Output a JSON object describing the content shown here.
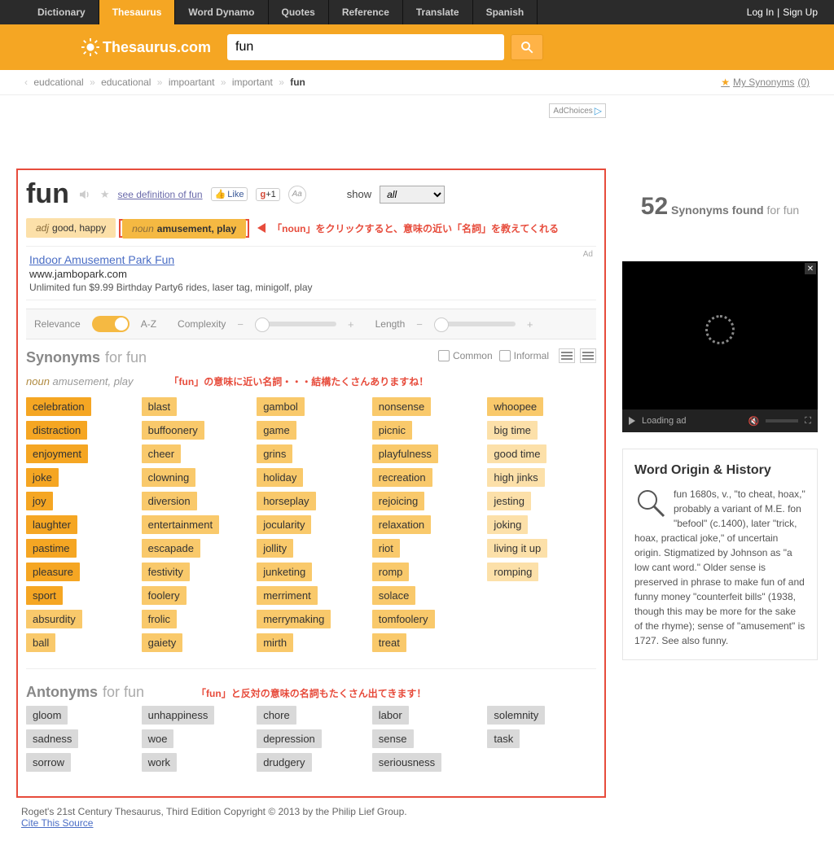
{
  "topnav": {
    "items": [
      "Dictionary",
      "Thesaurus",
      "Word Dynamo",
      "Quotes",
      "Reference",
      "Translate",
      "Spanish"
    ],
    "login": "Log In",
    "signup": "Sign Up"
  },
  "logo": "Thesaurus.com",
  "search": {
    "value": "fun"
  },
  "breadcrumbs": [
    "eudcational",
    "educational",
    "impoartant",
    "important",
    "fun"
  ],
  "my_synonyms": {
    "label": "My Synonyms",
    "count": "(0)"
  },
  "adchoices": "AdChoices",
  "word": "fun",
  "def_link": "see definition of fun",
  "fb_like": "Like",
  "gplus": "+1",
  "show_label": "show",
  "show_value": "all",
  "senses": [
    {
      "pos": "adj",
      "txt": "good, happy"
    },
    {
      "pos": "noun",
      "txt": "amusement, play"
    }
  ],
  "annot1": "「noun」をクリックすると、意味の近い「名詞」を教えてくれる",
  "ad": {
    "title": "Indoor Amusement Park Fun",
    "url": "www.jambopark.com",
    "desc": "Unlimited fun $9.99 Birthday Party6 rides, laser tag, minigolf, play",
    "tag": "Ad"
  },
  "controls": {
    "relevance": "Relevance",
    "az": "A-Z",
    "complexity": "Complexity",
    "length": "Length"
  },
  "section_syn": {
    "strong": "Synonyms",
    "light": "for fun"
  },
  "filters": {
    "common": "Common",
    "informal": "Informal"
  },
  "pos_sub": {
    "pos": "noun",
    "txt": "amusement, play"
  },
  "annot2": "「fun」の意味に近い名詞・・・結構たくさんありますね！",
  "syn_cols": [
    [
      {
        "t": "celebration",
        "s": 1
      },
      {
        "t": "distraction",
        "s": 1
      },
      {
        "t": "enjoyment",
        "s": 1
      },
      {
        "t": "joke",
        "s": 1
      },
      {
        "t": "joy",
        "s": 1
      },
      {
        "t": "laughter",
        "s": 1
      },
      {
        "t": "pastime",
        "s": 1
      },
      {
        "t": "pleasure",
        "s": 1
      },
      {
        "t": "sport",
        "s": 1
      },
      {
        "t": "absurdity",
        "s": 2
      },
      {
        "t": "ball",
        "s": 2
      }
    ],
    [
      {
        "t": "blast",
        "s": 2
      },
      {
        "t": "buffoonery",
        "s": 2
      },
      {
        "t": "cheer",
        "s": 2
      },
      {
        "t": "clowning",
        "s": 2
      },
      {
        "t": "diversion",
        "s": 2
      },
      {
        "t": "entertainment",
        "s": 2
      },
      {
        "t": "escapade",
        "s": 2
      },
      {
        "t": "festivity",
        "s": 2
      },
      {
        "t": "foolery",
        "s": 2
      },
      {
        "t": "frolic",
        "s": 2
      },
      {
        "t": "gaiety",
        "s": 2
      }
    ],
    [
      {
        "t": "gambol",
        "s": 2
      },
      {
        "t": "game",
        "s": 2
      },
      {
        "t": "grins",
        "s": 2
      },
      {
        "t": "holiday",
        "s": 2
      },
      {
        "t": "horseplay",
        "s": 2
      },
      {
        "t": "jocularity",
        "s": 2
      },
      {
        "t": "jollity",
        "s": 2
      },
      {
        "t": "junketing",
        "s": 2
      },
      {
        "t": "merriment",
        "s": 2
      },
      {
        "t": "merrymaking",
        "s": 2
      },
      {
        "t": "mirth",
        "s": 2
      }
    ],
    [
      {
        "t": "nonsense",
        "s": 2
      },
      {
        "t": "picnic",
        "s": 2
      },
      {
        "t": "playfulness",
        "s": 2
      },
      {
        "t": "recreation",
        "s": 2
      },
      {
        "t": "rejoicing",
        "s": 2
      },
      {
        "t": "relaxation",
        "s": 2
      },
      {
        "t": "riot",
        "s": 2
      },
      {
        "t": "romp",
        "s": 2
      },
      {
        "t": "solace",
        "s": 2
      },
      {
        "t": "tomfoolery",
        "s": 2
      },
      {
        "t": "treat",
        "s": 2
      }
    ],
    [
      {
        "t": "whoopee",
        "s": 2
      },
      {
        "t": "big time",
        "s": 3
      },
      {
        "t": "good time",
        "s": 3
      },
      {
        "t": "high jinks",
        "s": 3
      },
      {
        "t": "jesting",
        "s": 3
      },
      {
        "t": "joking",
        "s": 3
      },
      {
        "t": "living it up",
        "s": 3
      },
      {
        "t": "romping",
        "s": 3
      }
    ]
  ],
  "section_ant": {
    "strong": "Antonyms",
    "light": "for fun"
  },
  "annot3": "「fun」と反対の意味の名詞もたくさん出てきます！",
  "ant_cols": [
    [
      "gloom",
      "sadness",
      "sorrow"
    ],
    [
      "unhappiness",
      "woe",
      "work"
    ],
    [
      "chore",
      "depression",
      "drudgery"
    ],
    [
      "labor",
      "sense",
      "seriousness"
    ],
    [
      "solemnity",
      "task"
    ]
  ],
  "cite": {
    "text": "Roget's 21st Century Thesaurus, Third Edition Copyright © 2013 by the Philip Lief Group.",
    "link": "Cite This Source"
  },
  "side": {
    "count": "52",
    "found_strong": "Synonyms found",
    "found_light": "for fun",
    "loading": "Loading ad"
  },
  "origin": {
    "title": "Word Origin & History",
    "text": "fun 1680s, v., \"to cheat, hoax,\" probably a variant of M.E. fon \"befool\" (c.1400), later \"trick, hoax, practical joke,\" of uncertain origin. Stigmatized by Johnson as \"a low cant word.\" Older sense is preserved in phrase to make fun of and funny money \"counterfeit bills\" (1938, though this may be more for the sake of the rhyme); sense of \"amusement\" is 1727. See also funny."
  }
}
